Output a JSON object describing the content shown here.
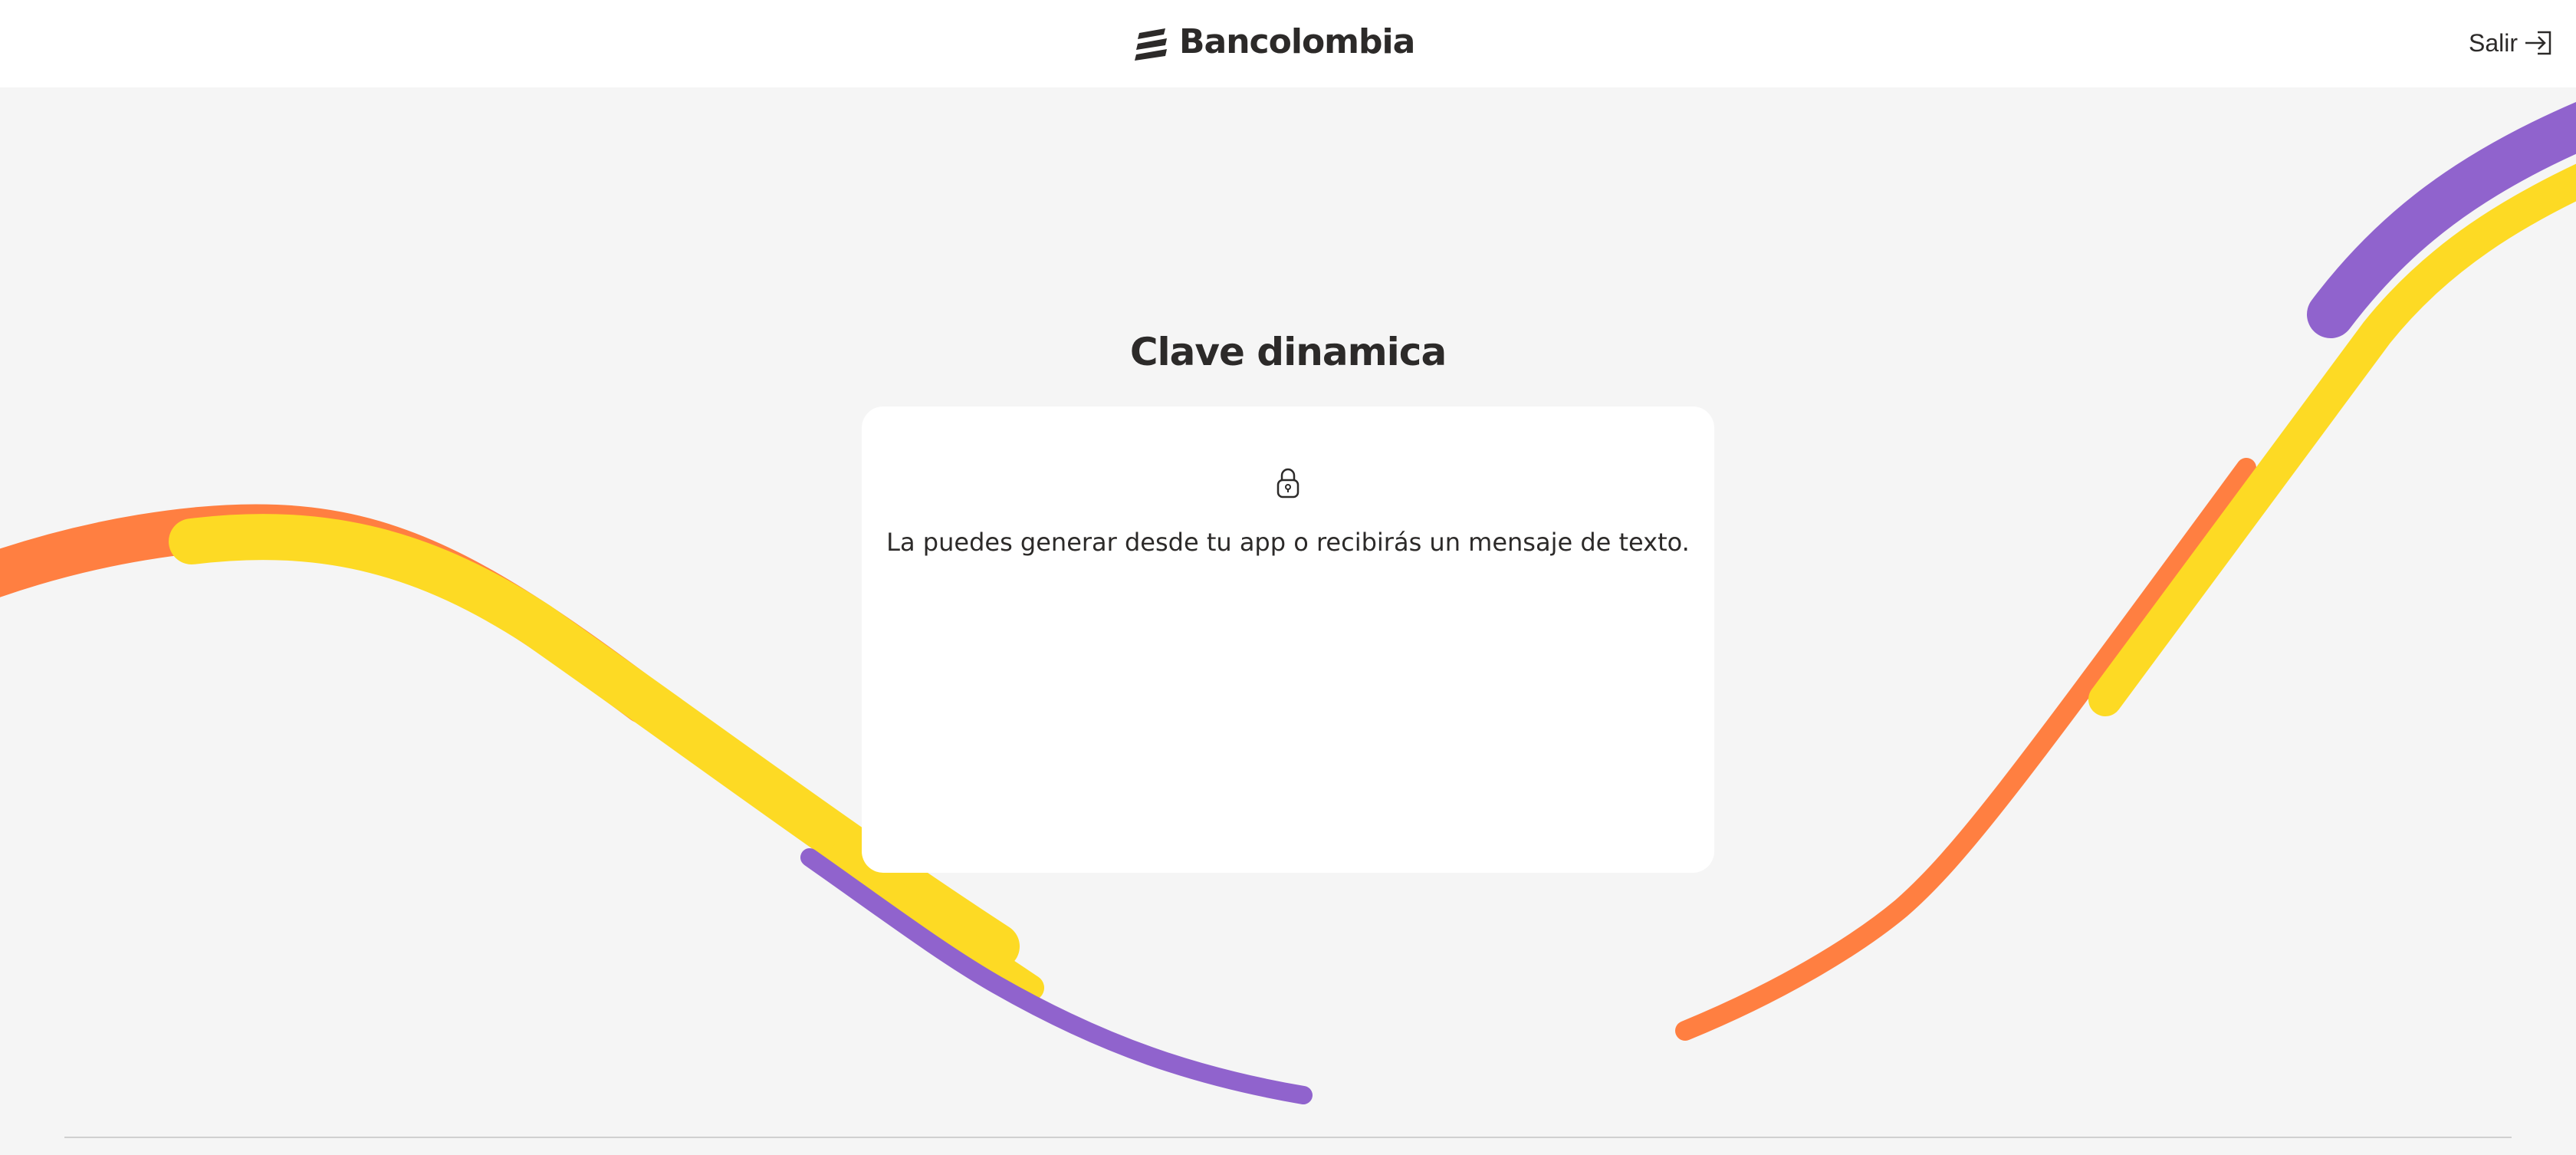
{
  "header": {
    "brand": "Bancolombia",
    "exit_label": "Salir"
  },
  "icons": {
    "logo": "bancolombia-logo-icon",
    "exit": "exit-icon",
    "lock": "lock-icon"
  },
  "main": {
    "title": "Clave dinamica",
    "message": "La puedes generar desde tu app o recibirás un mensaje de texto."
  },
  "colors": {
    "orange": "#ff7f41",
    "yellow": "#fdda24",
    "purple": "#9063cd",
    "background": "#f5f5f5",
    "text": "#2c2a29"
  }
}
